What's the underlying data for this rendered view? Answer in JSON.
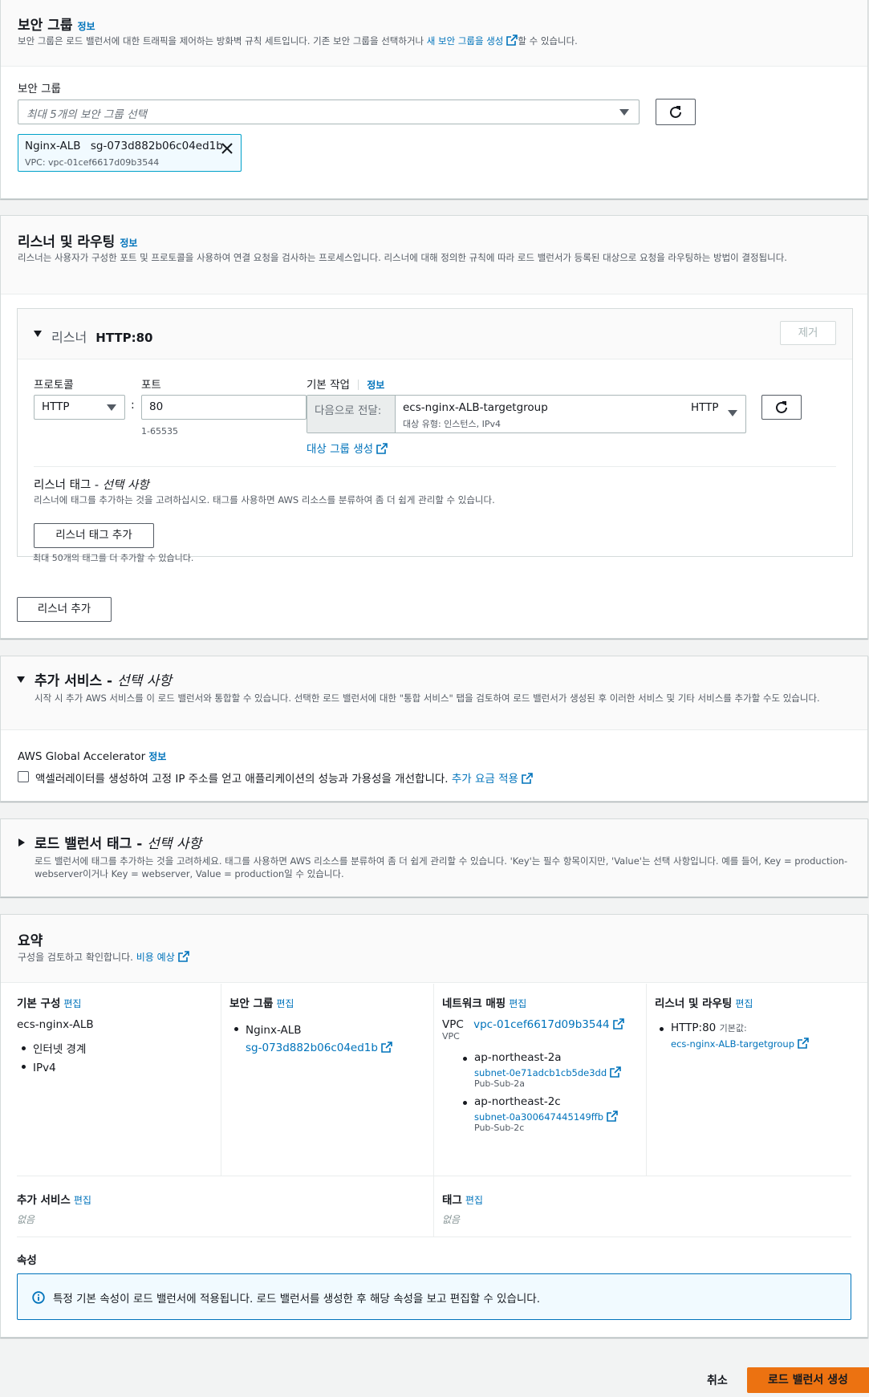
{
  "security_group": {
    "title": "보안 그룹",
    "info": "정보",
    "desc_prefix": "보안 그룹은 로드 밸런서에 대한 트래픽을 제어하는 방화벽 규칙 세트입니다. 기존 보안 그룹을 선택하거나",
    "desc_link": "새 보안 그룹을 생성",
    "desc_suffix": "할 수 있습니다.",
    "field_label": "보안 그룹",
    "select_placeholder": "최대 5개의 보안 그룹 선택",
    "token": {
      "name": "Nginx-ALB",
      "id": "sg-073d882b06c04ed1b",
      "vpc": "VPC: vpc-01cef6617d09b3544"
    }
  },
  "listeners": {
    "title": "리스너 및 라우팅",
    "info": "정보",
    "desc": "리스너는 사용자가 구성한 포트 및 프로토콜을 사용하여 연결 요청을 검사하는 프로세스입니다. 리스너에 대해 정의한 규칙에 따라 로드 밸런서가 등록된 대상으로 요청을 라우팅하는 방법이 결정됩니다.",
    "listener": {
      "title_prefix": "리스너",
      "title_name": "HTTP:80",
      "remove_label": "제거",
      "protocol_label": "프로토콜",
      "protocol_value": "HTTP",
      "colon": ":",
      "port_label": "포트",
      "port_value": "80",
      "port_hint": "1-65535",
      "default_action_label": "기본 작업",
      "default_action_info": "정보",
      "forward_to": "다음으로 전달:",
      "target_group_name": "ecs-nginx-ALB-targetgroup",
      "target_group_protocol": "HTTP",
      "target_group_type": "대상 유형: 인스턴스, IPv4",
      "create_target_group": "대상 그룹 생성",
      "tags_title": "리스너 태그 - ",
      "tags_title_optional": "선택 사항",
      "tags_desc": "리스너에 태그를 추가하는 것을 고려하십시오. 태그를 사용하면 AWS 리소스를 분류하여 좀 더 쉽게 관리할 수 있습니다.",
      "add_tag_label": "리스너 태그 추가",
      "tag_limit": "최대 50개의 태그를 더 추가할 수 있습니다."
    },
    "add_listener_label": "리스너 추가"
  },
  "addon": {
    "title": "추가 서비스 - ",
    "title_optional": "선택 사항",
    "desc": "시작 시 추가 AWS 서비스를 이 로드 밸런서와 통합할 수 있습니다. 선택한 로드 밸런서에 대한 \"통합 서비스\" 탭을 검토하여 로드 밸런서가 생성된 후 이러한 서비스 및 기타 서비스를 추가할 수도 있습니다.",
    "ga_label": "AWS Global Accelerator",
    "ga_info": "정보",
    "ga_checkbox_label": "액셀러레이터를 생성하여 고정 IP 주소를 얻고 애플리케이션의 성능과 가용성을 개선합니다.",
    "ga_pricing_link": "추가 요금 적용"
  },
  "lb_tags": {
    "title": "로드 밸런서 태그 - ",
    "title_optional": "선택 사항",
    "desc": "로드 밸런서에 태그를 추가하는 것을 고려하세요. 태그를 사용하면 AWS 리소스를 분류하여 좀 더 쉽게 관리할 수 있습니다. 'Key'는 필수 항목이지만, 'Value'는 선택 사항입니다. 예를 들어, Key = production-webserver이거나 Key = webserver, Value = production일 수 있습니다."
  },
  "summary": {
    "title": "요약",
    "desc": "구성을 검토하고 확인합니다.",
    "cost_link": "비용 예상",
    "edit": "편집",
    "basic": {
      "title": "기본 구성",
      "name": "ecs-nginx-ALB",
      "items": [
        "인터넷 경계",
        "IPv4"
      ]
    },
    "sg": {
      "title": "보안 그룹",
      "name": "Nginx-ALB",
      "id": "sg-073d882b06c04ed1b"
    },
    "network": {
      "title": "네트워크 매핑",
      "vpc_label": "VPC",
      "vpc_id": "vpc-01cef6617d09b3544",
      "vpc_sub": "VPC",
      "zones": [
        {
          "az": "ap-northeast-2a",
          "subnet": "subnet-0e71adcb1cb5de3dd",
          "name": "Pub-Sub-2a"
        },
        {
          "az": "ap-northeast-2c",
          "subnet": "subnet-0a300647445149ffb",
          "name": "Pub-Sub-2c"
        }
      ]
    },
    "listeners": {
      "title": "리스너 및 라우팅",
      "listener": "HTTP:80",
      "default_label": "기본값:",
      "target": "ecs-nginx-ALB-targetgroup"
    },
    "addons": {
      "title": "추가 서비스",
      "value": "없음"
    },
    "tags": {
      "title": "태그",
      "value": "없음"
    },
    "attributes": {
      "title": "속성",
      "alert": "특정 기본 속성이 로드 밸런서에 적용됩니다. 로드 밸런서를 생성한 후 해당 속성을 보고 편집할 수 있습니다."
    }
  },
  "footer": {
    "cancel": "취소",
    "create": "로드 밸런서 생성"
  },
  "colors": {
    "link": "#0073bb",
    "primary": "#ec7211",
    "token_border": "#00a1c9",
    "token_bg": "#f1faff",
    "info_border": "#0073bb",
    "info_bg": "#f1faff"
  }
}
